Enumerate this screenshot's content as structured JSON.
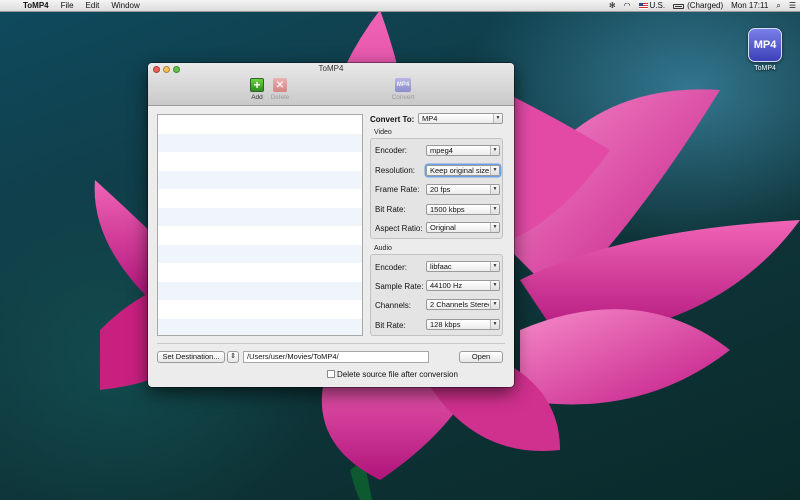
{
  "menubar": {
    "apple": "",
    "app_name": "ToMP4",
    "menus": [
      "File",
      "Edit",
      "Window"
    ],
    "status": {
      "bluetooth": "✻",
      "wifi": "◠",
      "input_source": "U.S.",
      "battery": "(Charged)",
      "clock": "Mon 17:11",
      "search": "⌕",
      "list": "☰"
    }
  },
  "desktop_icon": {
    "tile_text": "MP4",
    "label": "ToMP4"
  },
  "window": {
    "title": "ToMP4",
    "toolbar": {
      "add_label": "Add",
      "add_glyph": "+",
      "delete_label": "Delete",
      "delete_glyph": "✕",
      "convert_label": "Convert",
      "convert_glyph": "MP4"
    },
    "convert_to": {
      "label": "Convert To:",
      "value": "MP4"
    },
    "video": {
      "title": "Video",
      "encoder": {
        "label": "Encoder:",
        "value": "mpeg4"
      },
      "resolution": {
        "label": "Resolution:",
        "value": "Keep original size"
      },
      "frame_rate": {
        "label": "Frame Rate:",
        "value": "20 fps"
      },
      "bit_rate": {
        "label": "Bit Rate:",
        "value": "1500 kbps"
      },
      "aspect_ratio": {
        "label": "Aspect Ratio:",
        "value": "Original"
      }
    },
    "audio": {
      "title": "Audio",
      "encoder": {
        "label": "Encoder:",
        "value": "libfaac"
      },
      "sample_rate": {
        "label": "Sample Rate:",
        "value": "44100 Hz"
      },
      "channels": {
        "label": "Channels:",
        "value": "2 Channels Stereo"
      },
      "bit_rate": {
        "label": "Bit Rate:",
        "value": "128 kbps"
      }
    },
    "destination": {
      "button_label": "Set Destination...",
      "stepper_glyph": "⇕",
      "path": "/Users/user/Movies/ToMP4/",
      "open_label": "Open"
    },
    "delete_source": {
      "label": "Delete source file after conversion",
      "checked": false
    },
    "popup_arrow": "▼",
    "file_list": {
      "rows": 12
    }
  },
  "colors": {
    "accent_blue": "#6da0e6",
    "flower_pink": "#d8258f",
    "desktop_teal": "#10383f",
    "icon_indigo": "#3c40b8"
  }
}
